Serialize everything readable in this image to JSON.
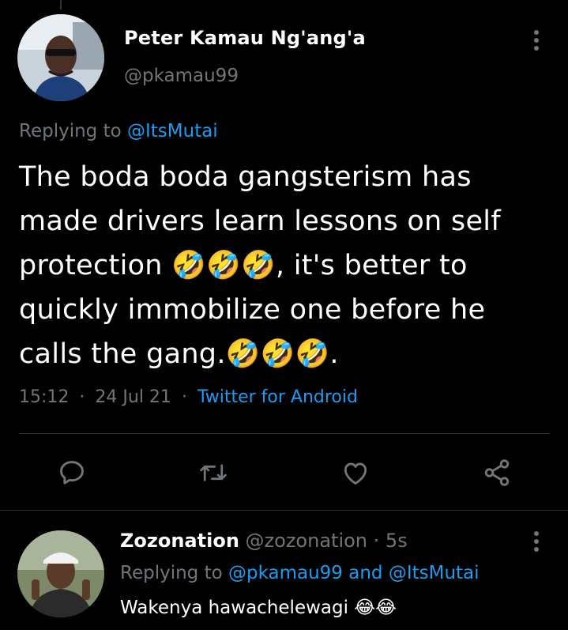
{
  "main_tweet": {
    "author_name": "Peter Kamau Ng'ang'a",
    "author_handle": "@pkamau99",
    "replying_prefix": "Replying to",
    "replying_mention": "@ItsMutai",
    "text": "The boda boda gangsterism has made drivers learn lessons on self protection 🤣🤣🤣, it's better to quickly immobilize one before he calls the gang.🤣🤣🤣.",
    "time": "15:12",
    "date": "24 Jul 21",
    "separator": "·",
    "source": "Twitter for Android",
    "actions": {
      "reply": "reply-icon",
      "retweet": "retweet-icon",
      "like": "heart-icon",
      "share": "share-icon"
    }
  },
  "reply_tweet": {
    "author_name": "Zozonation",
    "author_handle": "@zozonation",
    "separator": "·",
    "time": "5s",
    "replying_prefix": "Replying to",
    "replying_mentions": "@pkamau99 and @ItsMutai",
    "text": "Wakenya hawachelewagi 😂😂"
  },
  "colors": {
    "background": "#000000",
    "text_primary": "#ffffff",
    "text_secondary": "#71767b",
    "accent": "#1d9bf0",
    "divider": "#2f3336"
  }
}
